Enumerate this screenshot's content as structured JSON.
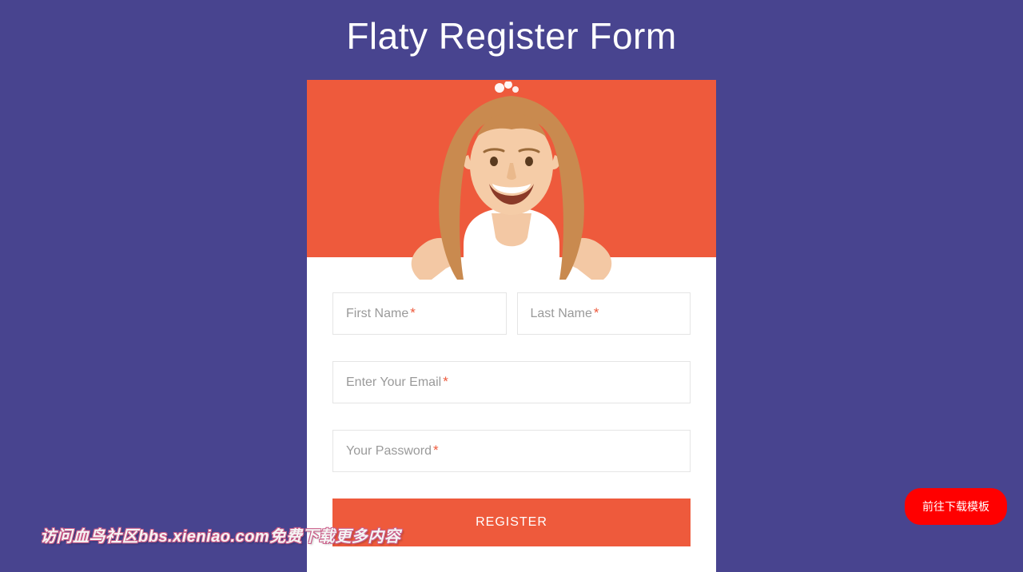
{
  "title": "Flaty Register Form",
  "form": {
    "first_name": {
      "label": "First Name",
      "value": ""
    },
    "last_name": {
      "label": "Last Name",
      "value": ""
    },
    "email": {
      "label": "Enter Your Email",
      "value": ""
    },
    "password": {
      "label": "Your Password",
      "value": ""
    },
    "submit_label": "REGISTER",
    "required_mark": "*"
  },
  "download_button_label": "前往下载模板",
  "watermark_text": "访问血鸟社区bbs.xieniao.com免费下载更多内容",
  "colors": {
    "page_bg": "#48448f",
    "accent": "#ee5a3c",
    "download_btn": "#ff0000"
  }
}
